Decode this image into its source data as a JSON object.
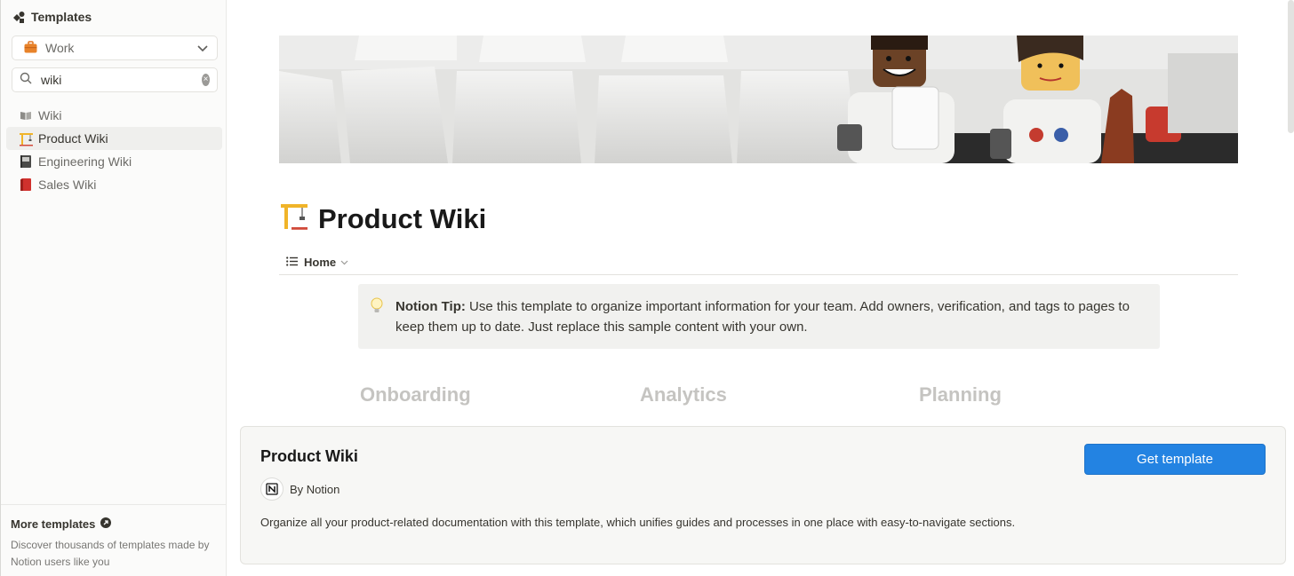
{
  "sidebar": {
    "title": "Templates",
    "category": {
      "selected": "Work"
    },
    "search": {
      "value": "wiki",
      "placeholder": "Search templates"
    },
    "items": [
      {
        "label": "Wiki",
        "icon": "book-icon"
      },
      {
        "label": "Product Wiki",
        "icon": "crane-icon",
        "active": true
      },
      {
        "label": "Engineering Wiki",
        "icon": "notebook-icon"
      },
      {
        "label": "Sales Wiki",
        "icon": "red-book-icon"
      }
    ],
    "more": {
      "title": "More templates",
      "description": "Discover thousands of templates made by Notion users like you"
    }
  },
  "preview": {
    "title": "Product Wiki",
    "tab": "Home",
    "callout": {
      "bold": "Notion Tip:",
      "text": " Use this template to organize important information for your team. Add owners, verification, and tags to pages to keep them up to date. Just replace this sample content with your own."
    },
    "sections": [
      "Onboarding",
      "Analytics",
      "Planning"
    ]
  },
  "card": {
    "title": "Product Wiki",
    "author": "By Notion",
    "description": "Organize all your product-related documentation with this template, which unifies guides and processes in one place with easy-to-navigate sections.",
    "button": "Get template"
  },
  "colors": {
    "accent": "#2383e2",
    "sidebar_bg": "#fbfbfa",
    "callout_bg": "#f1f1ef"
  }
}
